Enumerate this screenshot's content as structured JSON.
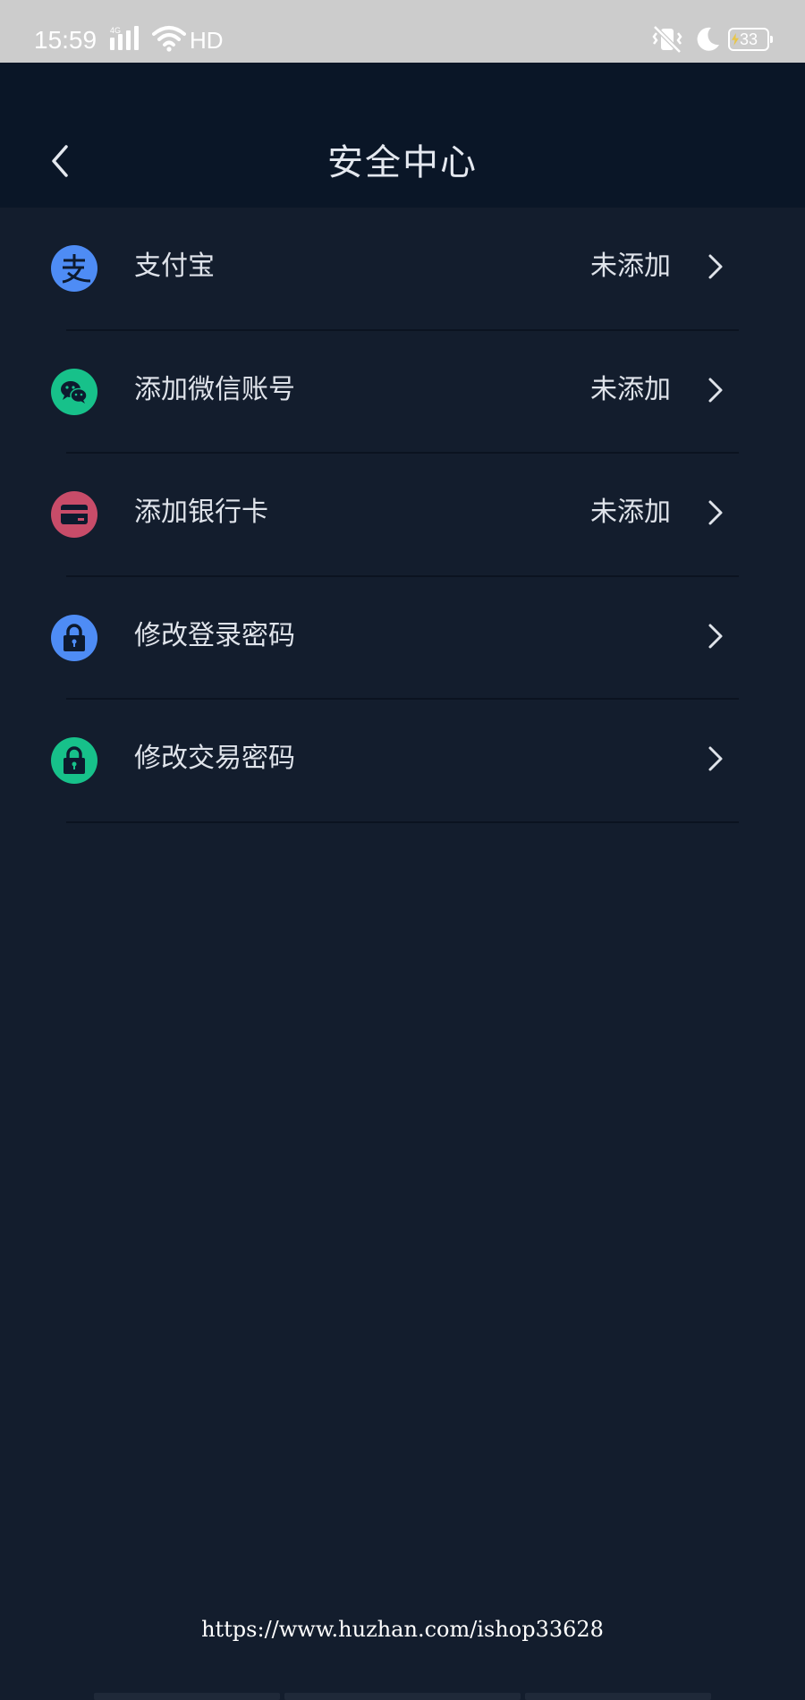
{
  "status_bar": {
    "time": "15:59",
    "network": "4G",
    "hd": "HD",
    "battery": "33",
    "icons": [
      "signal-icon",
      "wifi-icon",
      "vibrate-icon",
      "moon-icon",
      "battery-icon"
    ]
  },
  "header": {
    "title": "安全中心",
    "back_icon": "chevron-left-icon"
  },
  "menu": {
    "items": [
      {
        "label": "支付宝",
        "status": "未添加",
        "icon": "alipay-icon",
        "icon_color": "#4e8cf5"
      },
      {
        "label": "添加微信账号",
        "status": "未添加",
        "icon": "wechat-icon",
        "icon_color": "#17c18a"
      },
      {
        "label": "添加银行卡",
        "status": "未添加",
        "icon": "bank-card-icon",
        "icon_color": "#c84c69"
      },
      {
        "label": "修改登录密码",
        "status": "",
        "icon": "lock-icon",
        "icon_color": "#4e8cf5"
      },
      {
        "label": "修改交易密码",
        "status": "",
        "icon": "lock-icon",
        "icon_color": "#17c18a"
      }
    ]
  },
  "watermark": "https://www.huzhan.com/ishop33628",
  "colors": {
    "background": "#131d2d",
    "header": "#0a1627",
    "status_bar": "#cccccc",
    "text": "#dfe3ea"
  }
}
